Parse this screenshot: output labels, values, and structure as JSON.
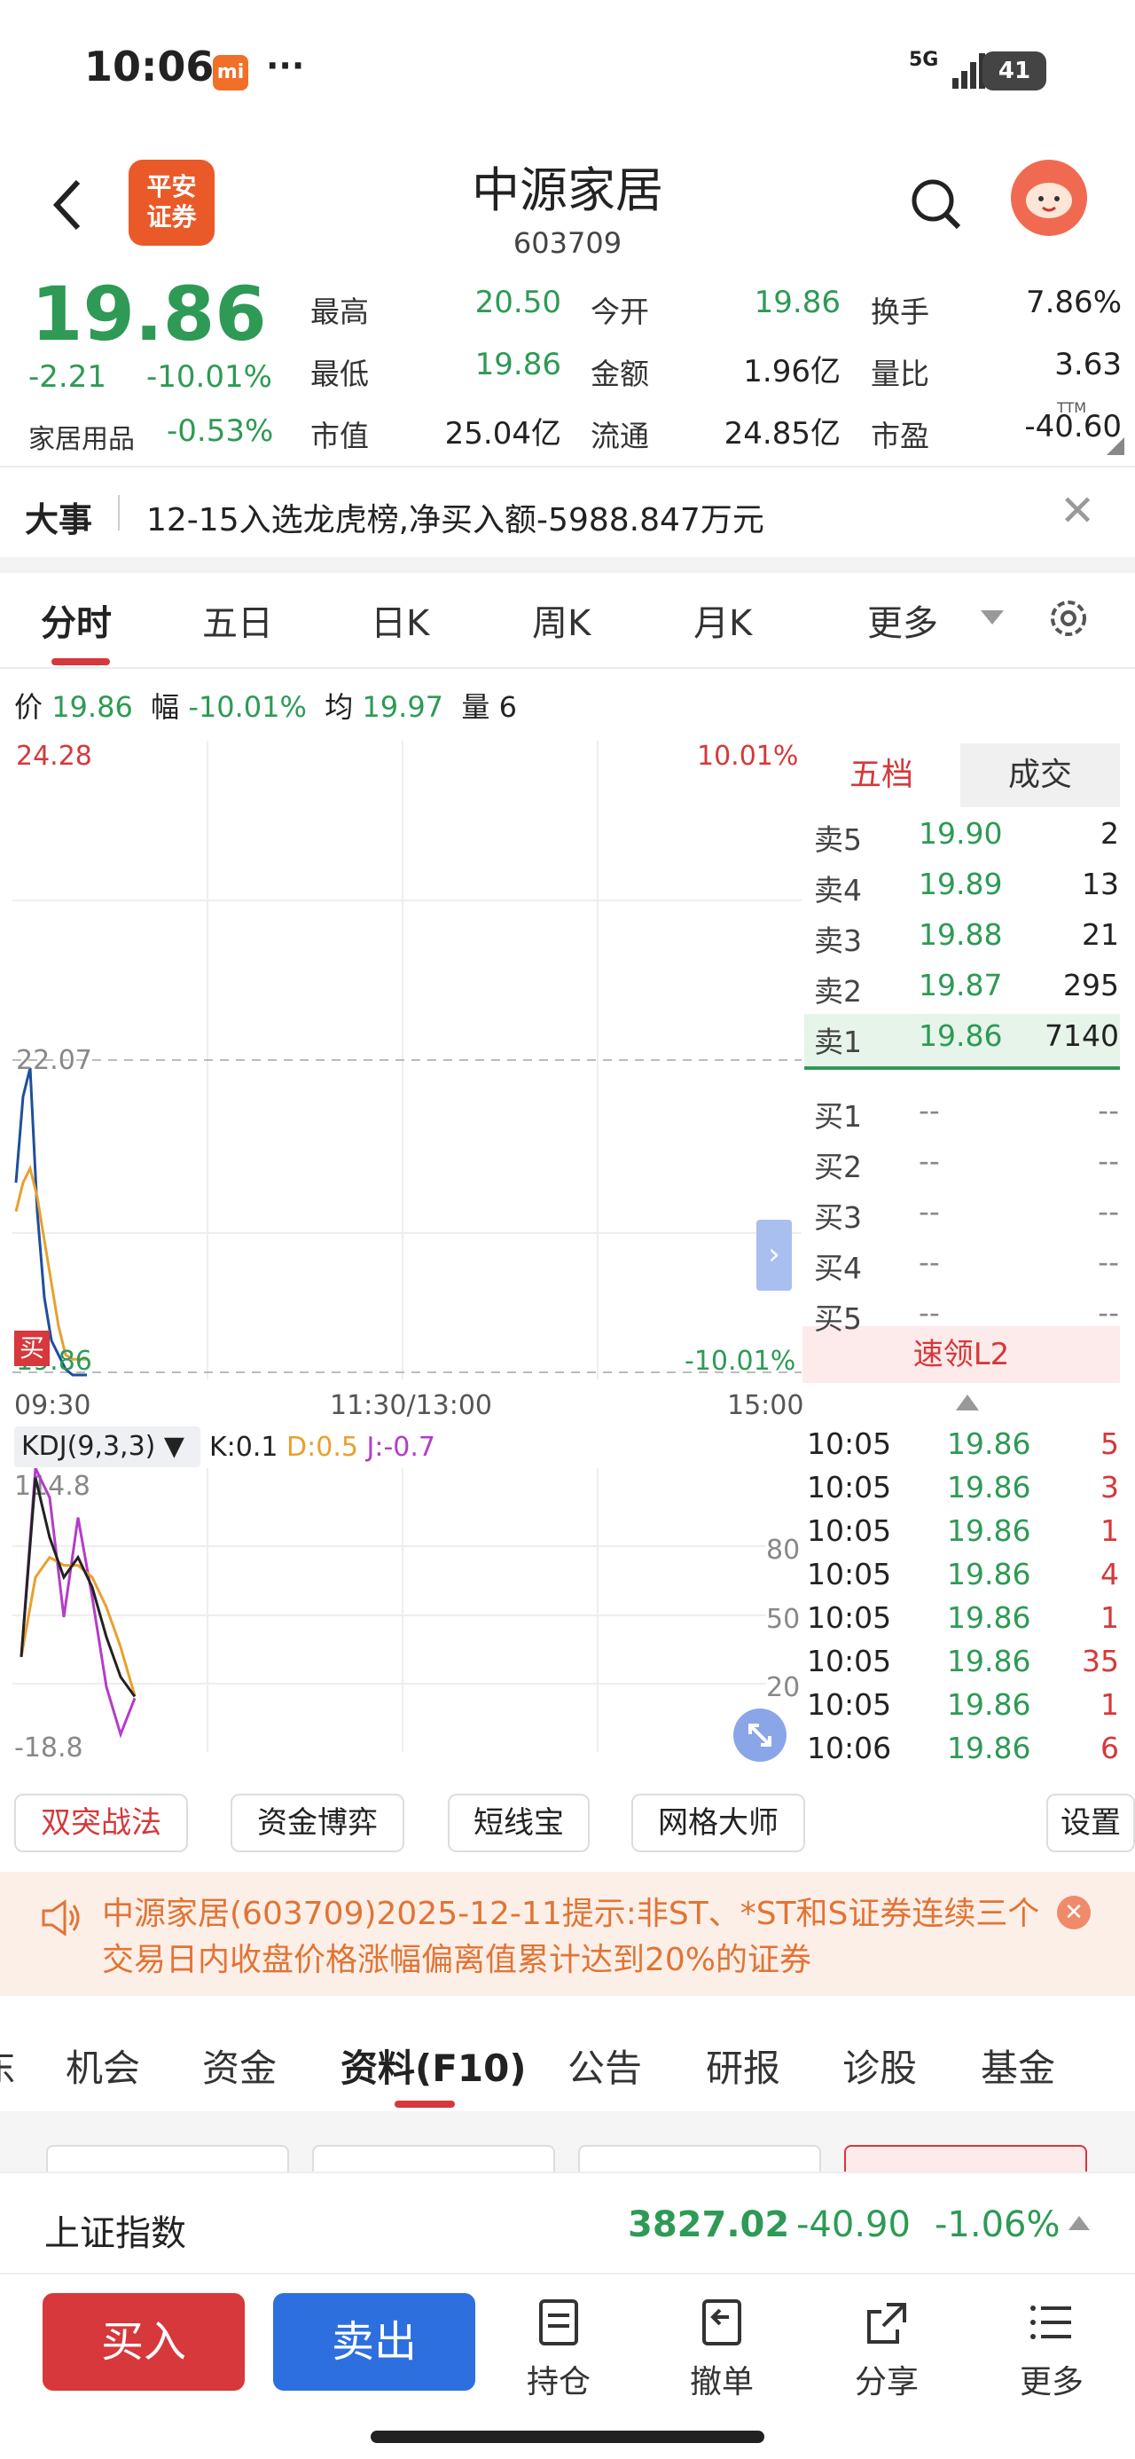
{
  "status": {
    "time": "10:06",
    "mi": "mi",
    "dots": "···",
    "net": "5G",
    "battery": "41"
  },
  "header": {
    "title": "中源家居",
    "code": "603709",
    "logo": "平安\n证券"
  },
  "quote": {
    "price": "19.86",
    "change": "-2.21",
    "pct": "-10.01%",
    "sector": "家居用品",
    "sector_pct": "-0.53%",
    "rows": [
      [
        {
          "l": "最高",
          "v": "20.50",
          "c": "green"
        },
        {
          "l": "今开",
          "v": "19.86",
          "c": "green"
        },
        {
          "l": "换手",
          "v": "7.86%",
          "c": ""
        }
      ],
      [
        {
          "l": "最低",
          "v": "19.86",
          "c": "green"
        },
        {
          "l": "金额",
          "v": "1.96亿",
          "c": ""
        },
        {
          "l": "量比",
          "v": "3.63",
          "c": ""
        }
      ],
      [
        {
          "l": "市值",
          "v": "25.04亿",
          "c": ""
        },
        {
          "l": "流通",
          "v": "24.85亿",
          "c": ""
        },
        {
          "l": "市盈",
          "v": "-40.60",
          "c": ""
        }
      ]
    ],
    "ttm": "TTM"
  },
  "news": {
    "tag": "大事",
    "text": "12-15入选龙虎榜,净买入额-5988.847万元"
  },
  "tabs": [
    "分时",
    "五日",
    "日K",
    "周K",
    "月K",
    "更多"
  ],
  "info": {
    "p_l": "价",
    "p": "19.86",
    "f_l": "幅",
    "f": "-10.01%",
    "a_l": "均",
    "a": "19.97",
    "v_l": "量",
    "v": "6"
  },
  "chart": {
    "ymax": "24.28",
    "ymid": "22.07",
    "ymin": "19.86",
    "pmax": "10.01%",
    "pmin": "-10.01%",
    "times": [
      "09:30",
      "11:30/13:00",
      "15:00"
    ],
    "buy_tag": "买",
    "kdj": {
      "label": "KDJ(9,3,3)",
      "k": "K:0.1",
      "d": "D:0.5",
      "j": "J:-0.7",
      "top": "114.8",
      "bottom": "-18.8",
      "lv": [
        "80",
        "50",
        "20"
      ]
    }
  },
  "chart_data": {
    "type": "line",
    "price": [
      21.2,
      21.8,
      22.0,
      21.0,
      20.4,
      20.1,
      20.0,
      19.9,
      19.86,
      19.86,
      19.86
    ],
    "avg": [
      21.0,
      21.2,
      21.3,
      21.1,
      20.8,
      20.5,
      20.2,
      20.0,
      19.97,
      19.97,
      19.97
    ],
    "k": [
      20,
      110,
      80,
      60,
      70,
      55,
      30,
      10,
      0.1
    ],
    "d": [
      20,
      60,
      70,
      66,
      66,
      60,
      45,
      25,
      0.5
    ],
    "j": [
      20,
      114.8,
      100,
      40,
      90,
      50,
      5,
      -18.8,
      -0.7
    ],
    "ylim": [
      19.86,
      24.28
    ]
  },
  "orderbook": {
    "tabs": [
      "五档",
      "成交"
    ],
    "asks": [
      [
        "卖5",
        "19.90",
        "2"
      ],
      [
        "卖4",
        "19.89",
        "13"
      ],
      [
        "卖3",
        "19.88",
        "21"
      ],
      [
        "卖2",
        "19.87",
        "295"
      ],
      [
        "卖1",
        "19.86",
        "7140"
      ]
    ],
    "bids": [
      [
        "买1",
        "--",
        "--"
      ],
      [
        "买2",
        "--",
        "--"
      ],
      [
        "买3",
        "--",
        "--"
      ],
      [
        "买4",
        "--",
        "--"
      ],
      [
        "买5",
        "--",
        "--"
      ]
    ],
    "l2": "速领L2"
  },
  "trades": [
    [
      "10:05",
      "19.86",
      "5"
    ],
    [
      "10:05",
      "19.86",
      "3"
    ],
    [
      "10:05",
      "19.86",
      "1"
    ],
    [
      "10:05",
      "19.86",
      "4"
    ],
    [
      "10:05",
      "19.86",
      "1"
    ],
    [
      "10:05",
      "19.86",
      "35"
    ],
    [
      "10:05",
      "19.86",
      "1"
    ],
    [
      "10:06",
      "19.86",
      "6"
    ]
  ],
  "chips": [
    "双突战法",
    "资金博弈",
    "短线宝",
    "网格大师",
    "设置"
  ],
  "notice": "中源家居(603709)2025-12-11提示:非ST、*ST和S证券连续三个交易日内收盘价格涨幅偏离值累计达到20%的证券",
  "btabs": [
    "东",
    "机会",
    "资金",
    "资料(F10)",
    "公告",
    "研报",
    "诊股",
    "基金"
  ],
  "index": {
    "name": "上证指数",
    "val": "3827.02",
    "chg": "-40.90",
    "pct": "-1.06%"
  },
  "bottom": {
    "buy": "买入",
    "sell": "卖出",
    "icons": [
      "持仓",
      "撤单",
      "分享",
      "更多"
    ]
  },
  "colors": {
    "red": "#d6383b",
    "green": "#2e9a55",
    "blue": "#2e6fe0"
  }
}
